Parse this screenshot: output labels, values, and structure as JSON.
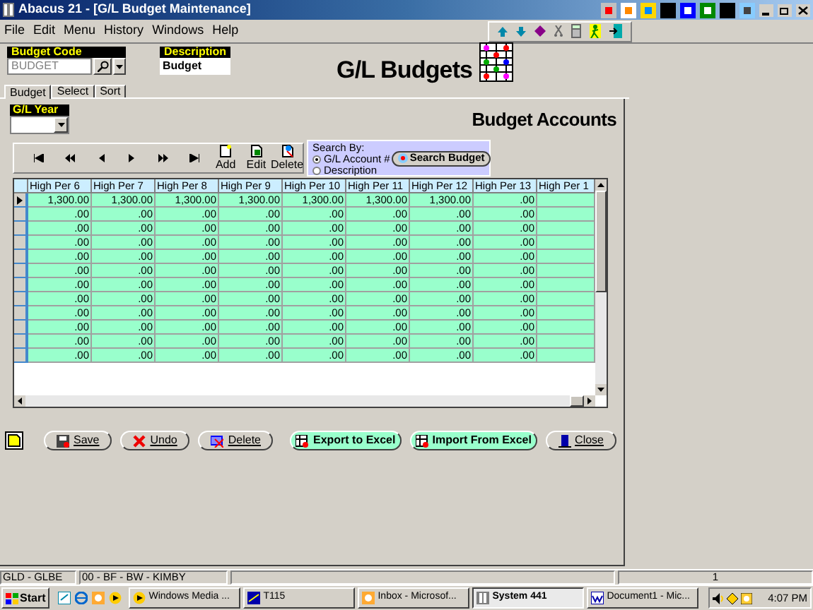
{
  "window": {
    "title": "Abacus 21 - [G/L Budget Maintenance]"
  },
  "menu": [
    "File",
    "Edit",
    "Menu",
    "History",
    "Windows",
    "Help"
  ],
  "budget_code": {
    "label": "Budget Code",
    "value": "BUDGET"
  },
  "description": {
    "label": "Description",
    "value": "Budget"
  },
  "page_title": "G/L Budgets",
  "tabs": [
    {
      "label": "Budget",
      "selected": true
    },
    {
      "label": "Select",
      "selected": false
    },
    {
      "label": "Sort",
      "selected": false
    }
  ],
  "gl_year": {
    "label": "G/L Year"
  },
  "section_title": "Budget Accounts",
  "record_buttons": [
    "Add",
    "Edit",
    "Delete"
  ],
  "search_by": {
    "label": "Search By:",
    "options": [
      {
        "label": "G/L Account #",
        "selected": true
      },
      {
        "label": "Description",
        "selected": false
      }
    ],
    "button": "Search Budget"
  },
  "table": {
    "columns": [
      "High Per 6",
      "High Per 7",
      "High Per 8",
      "High Per 9",
      "High Per 10",
      "High Per 11",
      "High Per 12",
      "High Per 13",
      "High Per 1"
    ],
    "rows": [
      {
        "selected": true,
        "cells": [
          "1,300.00",
          "1,300.00",
          "1,300.00",
          "1,300.00",
          "1,300.00",
          "1,300.00",
          "1,300.00",
          ".00"
        ]
      },
      {
        "selected": false,
        "cells": [
          ".00",
          ".00",
          ".00",
          ".00",
          ".00",
          ".00",
          ".00",
          ".00"
        ]
      },
      {
        "selected": false,
        "cells": [
          ".00",
          ".00",
          ".00",
          ".00",
          ".00",
          ".00",
          ".00",
          ".00"
        ]
      },
      {
        "selected": false,
        "cells": [
          ".00",
          ".00",
          ".00",
          ".00",
          ".00",
          ".00",
          ".00",
          ".00"
        ]
      },
      {
        "selected": false,
        "cells": [
          ".00",
          ".00",
          ".00",
          ".00",
          ".00",
          ".00",
          ".00",
          ".00"
        ]
      },
      {
        "selected": false,
        "cells": [
          ".00",
          ".00",
          ".00",
          ".00",
          ".00",
          ".00",
          ".00",
          ".00"
        ]
      },
      {
        "selected": false,
        "cells": [
          ".00",
          ".00",
          ".00",
          ".00",
          ".00",
          ".00",
          ".00",
          ".00"
        ]
      },
      {
        "selected": false,
        "cells": [
          ".00",
          ".00",
          ".00",
          ".00",
          ".00",
          ".00",
          ".00",
          ".00"
        ]
      },
      {
        "selected": false,
        "cells": [
          ".00",
          ".00",
          ".00",
          ".00",
          ".00",
          ".00",
          ".00",
          ".00"
        ]
      },
      {
        "selected": false,
        "cells": [
          ".00",
          ".00",
          ".00",
          ".00",
          ".00",
          ".00",
          ".00",
          ".00"
        ]
      },
      {
        "selected": false,
        "cells": [
          ".00",
          ".00",
          ".00",
          ".00",
          ".00",
          ".00",
          ".00",
          ".00"
        ]
      },
      {
        "selected": false,
        "cells": [
          ".00",
          ".00",
          ".00",
          ".00",
          ".00",
          ".00",
          ".00",
          ".00"
        ]
      }
    ]
  },
  "buttons": [
    {
      "label": "Save",
      "color": "#d4d0c8"
    },
    {
      "label": "Undo",
      "color": "#d4d0c8"
    },
    {
      "label": "Delete",
      "color": "#d4d0c8"
    },
    {
      "label": "Export to Excel",
      "color": "#99ffcc"
    },
    {
      "label": "Import From Excel",
      "color": "#99ffcc"
    },
    {
      "label": "Close",
      "color": "#d4d0c8"
    }
  ],
  "status_bar": [
    "GLD - GLBE",
    "00 - BF - BW - KIMBY",
    "1"
  ],
  "taskbar": {
    "start": "Start",
    "tasks": [
      {
        "label": "Windows Media ...",
        "selected": false
      },
      {
        "label": "T115",
        "selected": false
      },
      {
        "label": "Inbox - Microsof...",
        "selected": false
      },
      {
        "label": "System 441",
        "selected": true
      },
      {
        "label": "Document1 - Mic...",
        "selected": false
      }
    ],
    "clock": "4:07 PM"
  }
}
